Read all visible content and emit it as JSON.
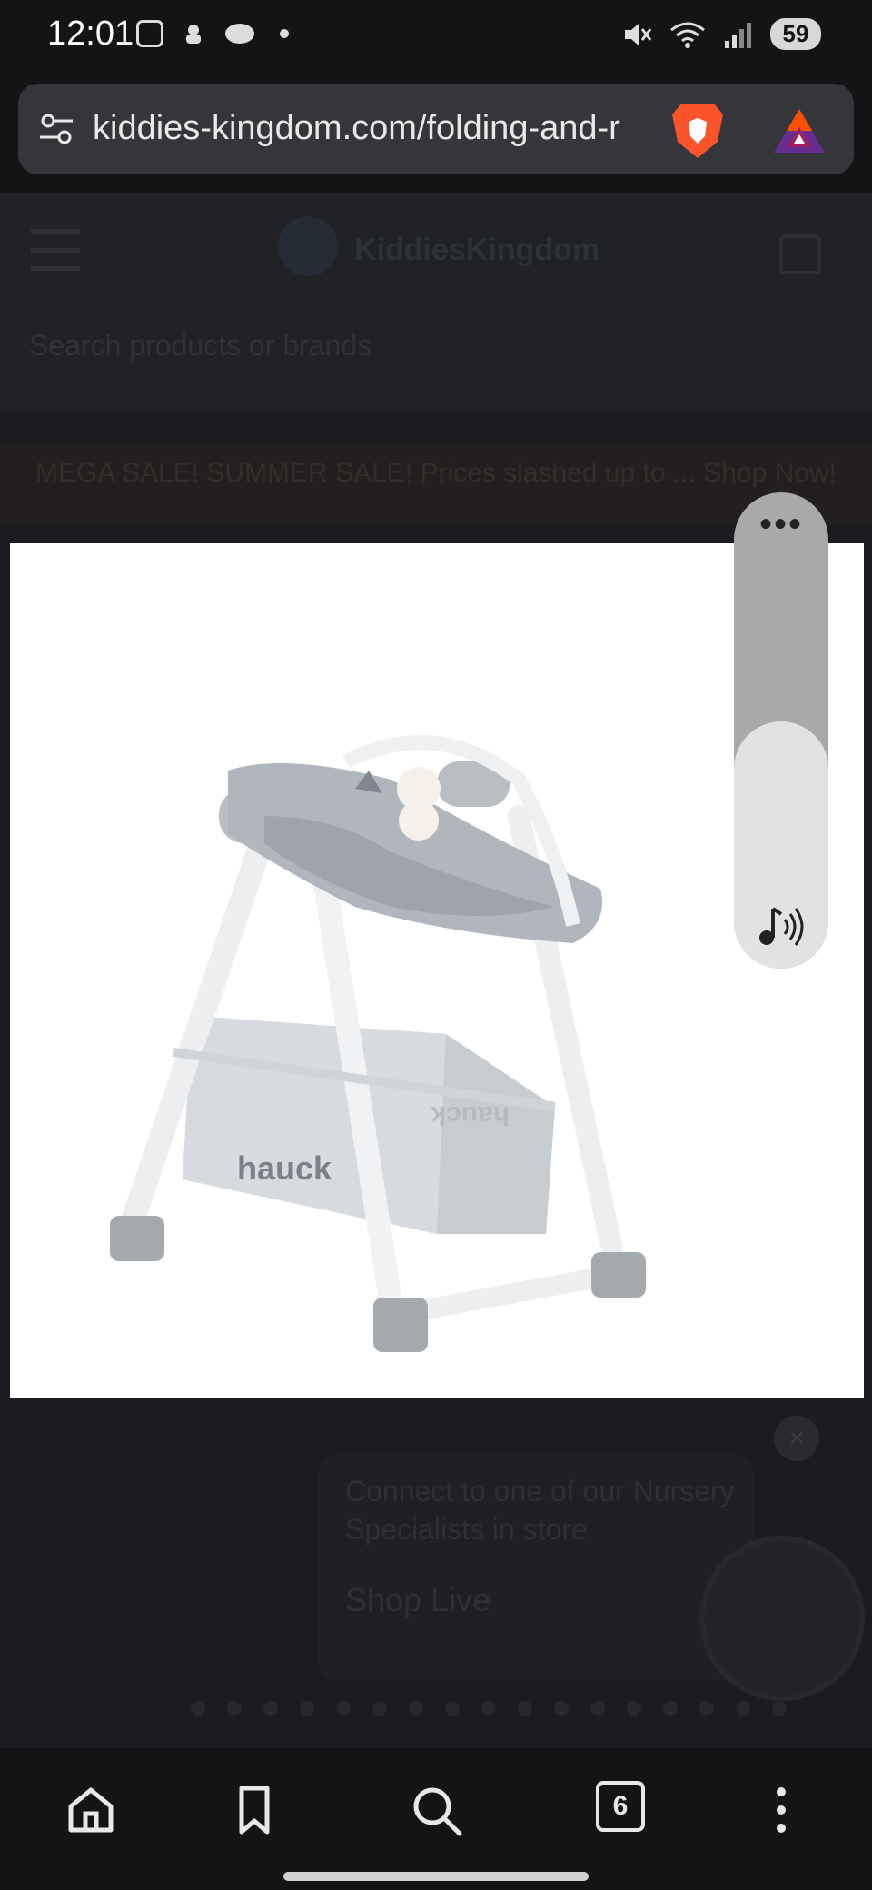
{
  "status_bar": {
    "time": "12:01",
    "battery": "59"
  },
  "browser": {
    "url": "kiddies-kingdom.com/folding-and-r",
    "tabs_count": "6"
  },
  "site": {
    "logo_text": "KiddiesKingdom",
    "search_placeholder": "Search products or brands",
    "promo_text": "MEGA SALE! SUMMER SALE! Prices slashed up to ... Shop Now!"
  },
  "chat_widget": {
    "message": "Connect to one of our Nursery Specialists in store",
    "link": "Shop Live"
  },
  "product_image": {
    "brand_label": "hauck"
  },
  "volume": {
    "level": 0.52
  },
  "colors": {
    "accent": "#f5a623",
    "brave": "#fb542b"
  }
}
